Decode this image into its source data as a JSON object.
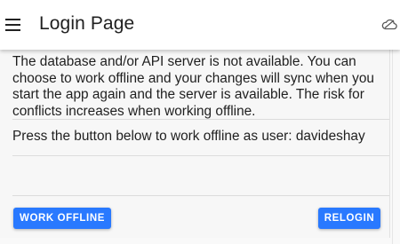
{
  "app_bar": {
    "title": "Login Page",
    "menu_icon": "hamburger-menu-icon",
    "status_icon": "cloud-icon"
  },
  "dialog": {
    "message": "The database and/or API server is not available. You can choose to work offline and your changes will sync when you start the app again and the server is available. The risk for conflicts increases when working offline.",
    "instruction": "Press the button below to work offline as user: davideshay"
  },
  "actions": {
    "work_offline_label": "WORK OFFLINE",
    "relogin_label": "RELOGIN"
  },
  "colors": {
    "accent": "#2979ff",
    "text": "#1f1f1f",
    "background": "#f7f7f7"
  }
}
